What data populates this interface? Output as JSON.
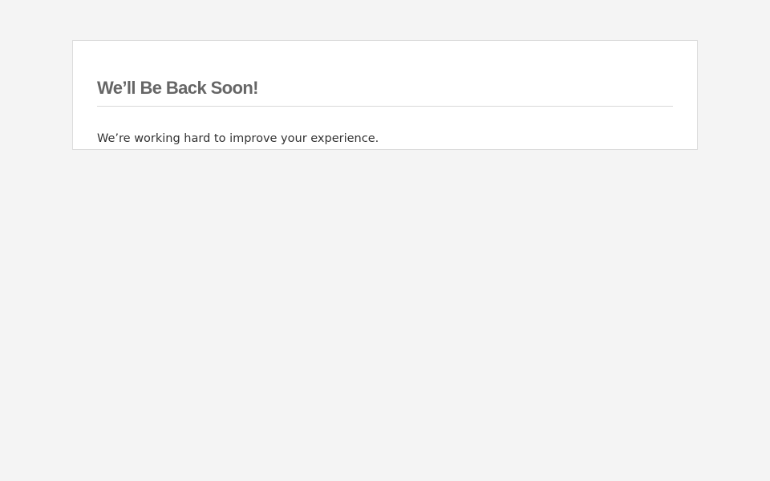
{
  "maintenance": {
    "title": "We’ll Be Back Soon!",
    "message": "We’re working hard to improve your experience."
  },
  "colors": {
    "background": "#f4f4f4",
    "card": "#ffffff",
    "title": "#666666",
    "text": "#333333"
  }
}
